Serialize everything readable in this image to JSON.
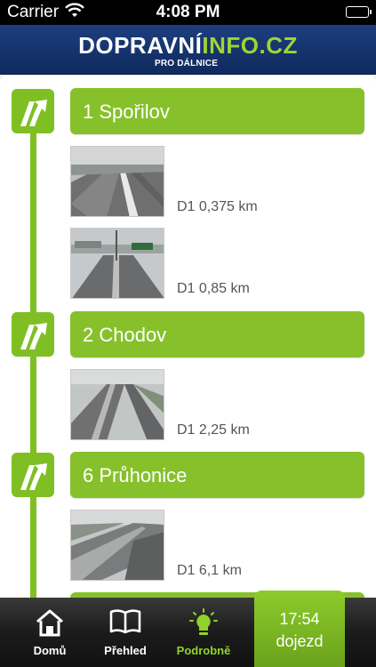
{
  "status_bar": {
    "carrier": "Carrier",
    "time": "4:08 PM"
  },
  "header": {
    "logo_main_a": "DOPRAVNÍ",
    "logo_main_b": "INFO.CZ",
    "logo_sub": "PRO DÁLNICE"
  },
  "exits": [
    {
      "label": "1 Spořilov",
      "cameras": [
        {
          "label": "D1 0,375 km"
        },
        {
          "label": "D1 0,85 km"
        }
      ]
    },
    {
      "label": "2 Chodov",
      "cameras": [
        {
          "label": "D1 2,25 km"
        }
      ]
    },
    {
      "label": "6 Průhonice",
      "cameras": [
        {
          "label": "D1 6,1 km"
        }
      ]
    }
  ],
  "tabbar": {
    "home": "Domů",
    "overview": "Přehled",
    "detail": "Podrobně",
    "eta_time": "17:54",
    "eta_label": "dojezd"
  },
  "colors": {
    "accent_green": "#86c12b",
    "header_blue": "#1d3f7e"
  }
}
